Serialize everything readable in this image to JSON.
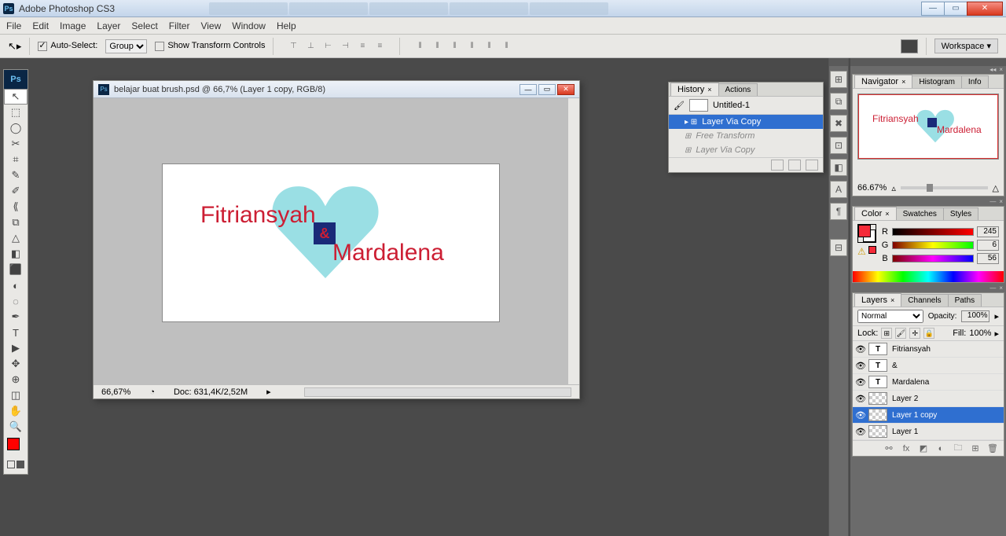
{
  "window": {
    "title": "Adobe Photoshop CS3"
  },
  "menu": [
    "File",
    "Edit",
    "Image",
    "Layer",
    "Select",
    "Filter",
    "View",
    "Window",
    "Help"
  ],
  "options": {
    "autoSelect": "Auto-Select:",
    "group": "Group",
    "showTransform": "Show Transform Controls",
    "workspace": "Workspace ▾"
  },
  "document": {
    "title": "belajar buat brush.psd @ 66,7% (Layer 1 copy, RGB/8)",
    "zoom": "66,67%",
    "docsize": "Doc: 631,4K/2,52M",
    "text1": "Fitriansyah",
    "amp": "&",
    "text2": "Mardalena"
  },
  "history": {
    "tabs": [
      "History",
      "Actions"
    ],
    "snapshot": "Untitled-1",
    "rows": [
      {
        "label": "Layer Via Copy",
        "sel": true
      },
      {
        "label": "Free Transform",
        "dim": true
      },
      {
        "label": "Layer Via Copy",
        "dim": true
      }
    ]
  },
  "navigator": {
    "tabs": [
      "Navigator",
      "Histogram",
      "Info"
    ],
    "zoom": "66.67%"
  },
  "color": {
    "tabs": [
      "Color",
      "Swatches",
      "Styles"
    ],
    "r": {
      "label": "R",
      "val": "245"
    },
    "g": {
      "label": "G",
      "val": "6"
    },
    "b": {
      "label": "B",
      "val": "56"
    }
  },
  "layers": {
    "tabs": [
      "Layers",
      "Channels",
      "Paths"
    ],
    "blendMode": "Normal",
    "opacityLbl": "Opacity:",
    "opacity": "100%",
    "lockLbl": "Lock:",
    "fillLbl": "Fill:",
    "fill": "100%",
    "rows": [
      {
        "name": "Fitriansyah",
        "type": "T"
      },
      {
        "name": "&",
        "type": "T"
      },
      {
        "name": "Mardalena",
        "type": "T"
      },
      {
        "name": "Layer 2",
        "type": "chk"
      },
      {
        "name": "Layer 1 copy",
        "type": "chk",
        "sel": true
      },
      {
        "name": "Layer 1",
        "type": "chk"
      }
    ]
  },
  "tools": [
    "↖",
    "⬚",
    "◯",
    "✂",
    "⌗",
    "✎",
    "✐",
    "⟪",
    "⧉",
    "△",
    "◧",
    "⬛",
    "◐",
    "◌",
    "✒",
    "T",
    "▶",
    "✥",
    "⊕",
    "◫",
    "✋",
    "🔍"
  ]
}
